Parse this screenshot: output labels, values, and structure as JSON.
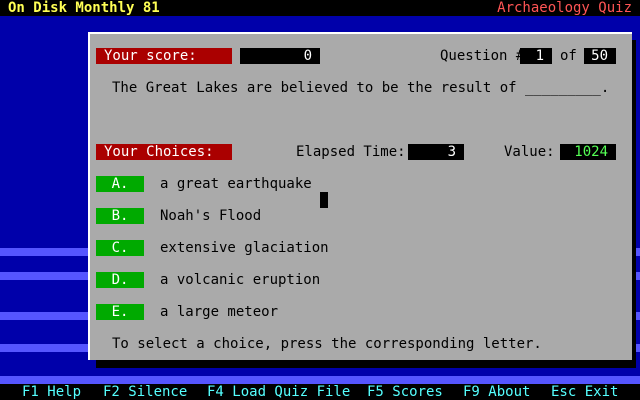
{
  "header": {
    "left_title": "On Disk Monthly 81",
    "right_title": "Archaeology Quiz"
  },
  "score": {
    "label": "Your score:",
    "value": "0"
  },
  "question": {
    "label": "Question #",
    "number": "1",
    "of_label": "of",
    "total": "50",
    "text": "The Great Lakes are believed to be the result of _________."
  },
  "choices_header": {
    "label": "Your Choices:",
    "elapsed_label": "Elapsed Time:",
    "elapsed_value": "3",
    "value_label": "Value:",
    "value_amount": "1024"
  },
  "choices": [
    {
      "letter": "A.",
      "text": "a great earthquake"
    },
    {
      "letter": "B.",
      "text": "Noah's Flood"
    },
    {
      "letter": "C.",
      "text": "extensive glaciation"
    },
    {
      "letter": "D.",
      "text": "a volcanic eruption"
    },
    {
      "letter": "E.",
      "text": "a large meteor"
    }
  ],
  "instruction": "To select a choice, press the corresponding letter.",
  "function_keys": [
    {
      "label": "F1 Help"
    },
    {
      "label": "F2 Silence"
    },
    {
      "label": "F4 Load Quiz File"
    },
    {
      "label": "F5 Scores"
    },
    {
      "label": "F9 About"
    },
    {
      "label": "Esc Exit"
    }
  ],
  "colors": {
    "background": "#0000aa",
    "panel": "#aaaaaa",
    "label_red": "#aa0000",
    "button_green": "#00aa00",
    "value_green": "#55ff55",
    "title_yellow": "#ffff55",
    "title_red": "#ff5555",
    "fkey_cyan": "#55ffff",
    "stripe": "#5555ff"
  }
}
